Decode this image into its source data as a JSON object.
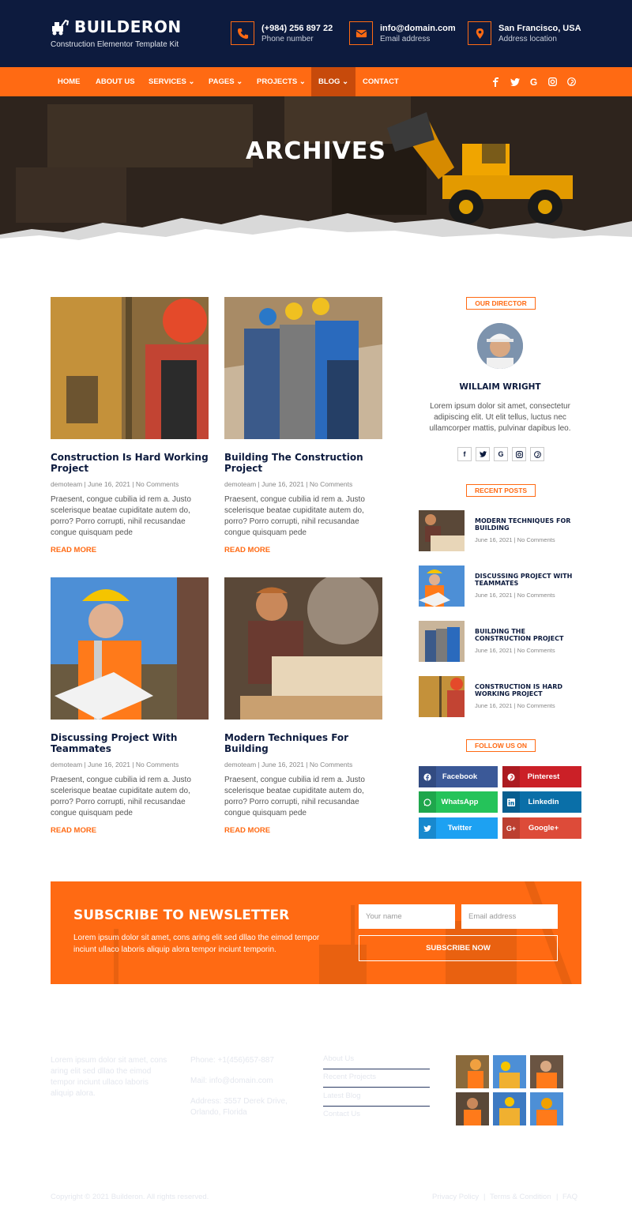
{
  "brand": {
    "name": "BUILDERON",
    "tagline": "Construction Elementor Template Kit"
  },
  "header": {
    "contacts": [
      {
        "icon": "phone-icon",
        "line1": "(+984) 256 897 22",
        "line2": "Phone number"
      },
      {
        "icon": "mail-icon",
        "line1": "info@domain.com",
        "line2": "Email address"
      },
      {
        "icon": "location-pin-icon",
        "line1": "San Francisco, USA",
        "line2": "Address location"
      }
    ]
  },
  "nav": {
    "items": [
      {
        "label": "HOME",
        "dropdown": false
      },
      {
        "label": "ABOUT US",
        "dropdown": false
      },
      {
        "label": "SERVICES",
        "dropdown": true
      },
      {
        "label": "PAGES",
        "dropdown": true
      },
      {
        "label": "PROJECTS",
        "dropdown": true
      },
      {
        "label": "BLOG",
        "dropdown": true,
        "active": true
      },
      {
        "label": "CONTACT",
        "dropdown": false
      }
    ],
    "social": [
      "facebook-icon",
      "twitter-icon",
      "google-icon",
      "instagram-icon",
      "pinterest-icon"
    ]
  },
  "hero": {
    "title": "ARCHIVES"
  },
  "posts": [
    {
      "title": "Construction Is Hard Working Project",
      "meta": "demoteam | June 16, 2021 | No Comments",
      "excerpt": "Praesent, congue cubilia id rem a. Justo scelerisque beatae cupiditate autem do, porro? Porro corrupti, nihil recusandae congue quisquam pede",
      "read_more": "READ MORE"
    },
    {
      "title": "Building The Construction Project",
      "meta": "demoteam | June 16, 2021 | No Comments",
      "excerpt": "Praesent, congue cubilia id rem a. Justo scelerisque beatae cupiditate autem do, porro? Porro corrupti, nihil recusandae congue quisquam pede",
      "read_more": "READ MORE"
    },
    {
      "title": "Discussing Project With Teammates",
      "meta": "demoteam | June 16, 2021 | No Comments",
      "excerpt": "Praesent, congue cubilia id rem a. Justo scelerisque beatae cupiditate autem do, porro? Porro corrupti, nihil recusandae congue quisquam pede",
      "read_more": "READ MORE"
    },
    {
      "title": "Modern Techniques For Building",
      "meta": "demoteam | June 16, 2021 | No Comments",
      "excerpt": "Praesent, congue cubilia id rem a. Justo scelerisque beatae cupiditate autem do, porro? Porro corrupti, nihil recusandae congue quisquam pede",
      "read_more": "READ MORE"
    }
  ],
  "sidebar": {
    "director": {
      "badge": "OUR DIRECTOR",
      "name": "WILLAIM WRIGHT",
      "bio": "Lorem ipsum dolor sit amet, consectetur adipiscing elit. Ut elit tellus, luctus nec ullamcorper mattis, pulvinar dapibus leo.",
      "social": [
        "facebook-icon",
        "twitter-icon",
        "google-icon",
        "instagram-icon",
        "pinterest-icon"
      ]
    },
    "recent": {
      "badge": "RECENT POSTS",
      "items": [
        {
          "title": "MODERN TECHNIQUES FOR BUILDING",
          "meta": "June 16, 2021 | No Comments"
        },
        {
          "title": "DISCUSSING PROJECT WITH TEAMMATES",
          "meta": "June 16, 2021 | No Comments"
        },
        {
          "title": "BUILDING THE CONSTRUCTION PROJECT",
          "meta": "June 16, 2021 | No Comments"
        },
        {
          "title": "CONSTRUCTION IS HARD WORKING PROJECT",
          "meta": "June 16, 2021 | No Comments"
        }
      ]
    },
    "follow": {
      "badge": "FOLLOW US ON",
      "buttons": [
        {
          "label": "Facebook",
          "icon": "facebook-icon",
          "color": "#3b5998"
        },
        {
          "label": "Pinterest",
          "icon": "pinterest-icon",
          "color": "#cb2027"
        },
        {
          "label": "WhatsApp",
          "icon": "whatsapp-icon",
          "color": "#25c35a"
        },
        {
          "label": "Linkedin",
          "icon": "linkedin-icon",
          "color": "#0a6fa8"
        },
        {
          "label": "Twitter",
          "icon": "twitter-icon",
          "color": "#1da1f2"
        },
        {
          "label": "Google+",
          "icon": "google-plus-icon",
          "color": "#dd4b39"
        }
      ]
    }
  },
  "newsletter": {
    "title": "SUBSCRIBE TO NEWSLETTER",
    "text": "Lorem ipsum dolor sit amet, cons aring elit sed dllao the eimod tempor inciunt ullaco laboris aliquip alora tempor inciunt temporin.",
    "name_placeholder": "Your name",
    "email_placeholder": "Email address",
    "button": "SUBSCRIBE NOW"
  },
  "footer": {
    "about": "Lorem ipsum dolor sit amet, cons aring elit sed dllao the eimod tempor inciunt ullaco laboris aliquip alora.",
    "contact": {
      "heading": "CONTACT INFORMATION",
      "phone": "Phone: +1(456)657-887",
      "mail": "Mail: info@domain.com",
      "address": "Address: 3557 Derek Drive, Orlando, Florida"
    },
    "links": {
      "heading": "USEFUL LINKS",
      "items": [
        "About Us",
        "Recent Projects",
        "Latest Blog",
        "Contact Us"
      ]
    },
    "gallery": {
      "heading": "GALLERY"
    },
    "copyright": "Copyright © 2021 Builderon. All rights reserved.",
    "bottom_links": [
      "Privacy Policy",
      "Terms & Condition",
      "FAQ"
    ]
  },
  "colors": {
    "accent": "#ff6a13",
    "navy": "#0d1b3e"
  }
}
